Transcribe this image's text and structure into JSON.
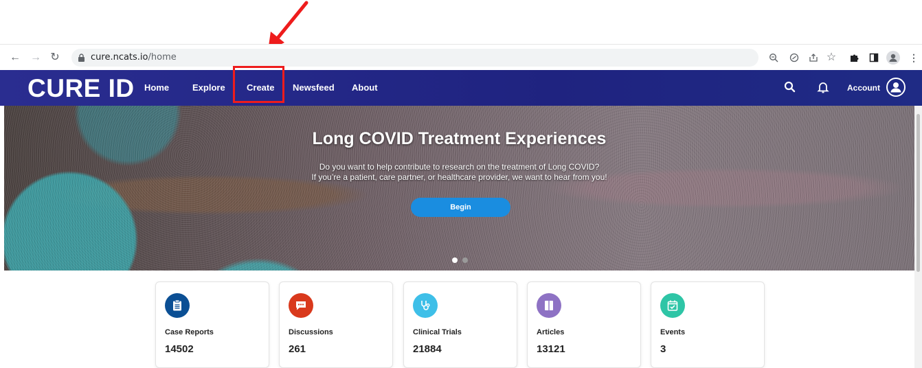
{
  "browser": {
    "url_domain": "cure.ncats.io",
    "url_path": "/home"
  },
  "navbar": {
    "logo": "CURE ID",
    "links": [
      "Home",
      "Explore",
      "Create",
      "Newsfeed",
      "About"
    ],
    "account_label": "Account",
    "color": "#2a2d90"
  },
  "hero": {
    "title": "Long COVID Treatment Experiences",
    "subtitle_line1": "Do you want to help contribute to research on the treatment of Long COVID?",
    "subtitle_line2": "If you’re a patient, care partner, or healthcare provider, we want to hear from you!",
    "cta": "Begin",
    "slides_total": 2,
    "slide_active": 1
  },
  "stats": [
    {
      "label": "Case Reports",
      "count": "14502",
      "color": "#0b4f94",
      "icon": "clipboard-icon"
    },
    {
      "label": "Discussions",
      "count": "261",
      "color": "#d9391c",
      "icon": "chat-bubble-icon"
    },
    {
      "label": "Clinical Trials",
      "count": "21884",
      "color": "#3ebfe8",
      "icon": "stethoscope-icon"
    },
    {
      "label": "Articles",
      "count": "13121",
      "color": "#8e72c4",
      "icon": "book-icon"
    },
    {
      "label": "Events",
      "count": "3",
      "color": "#2ec5a6",
      "icon": "calendar-check-icon"
    }
  ],
  "annotation": {
    "highlight_target": "Create",
    "color": "#ee1c1c"
  }
}
